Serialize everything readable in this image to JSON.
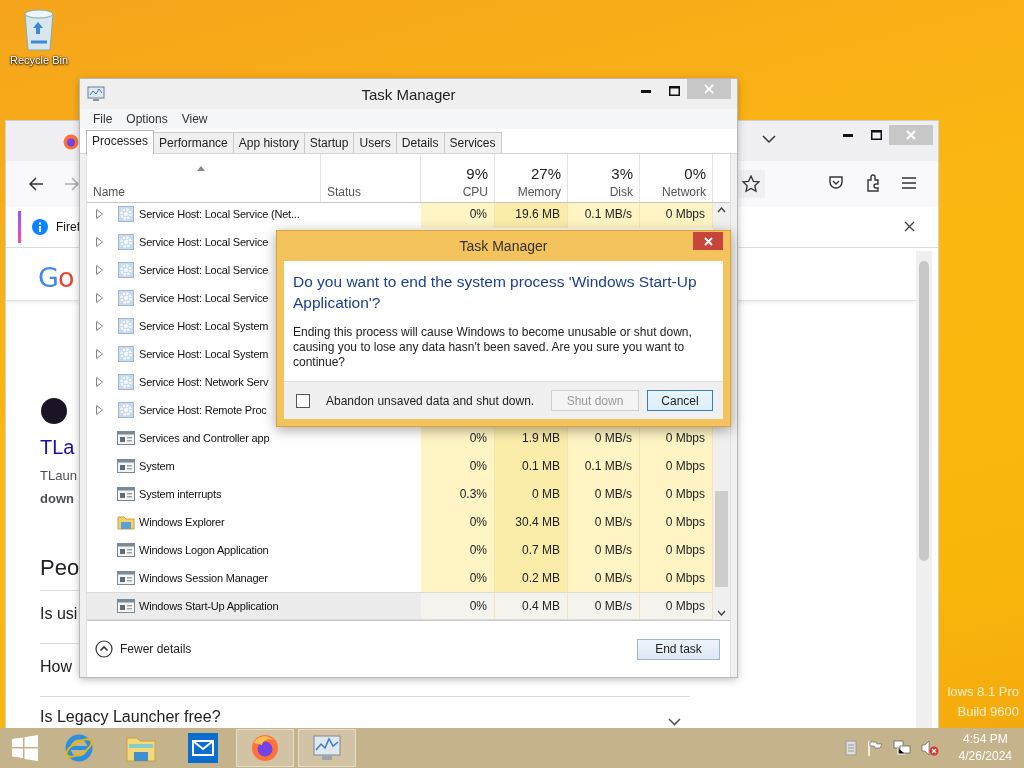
{
  "desktop": {
    "icons": [
      {
        "label": "Recycle Bin"
      }
    ],
    "edition_text": [
      "lows 8.1 Pro",
      "Build 9600"
    ]
  },
  "browser": {
    "notification": "Firef",
    "page": {
      "logo": "Go",
      "result": {
        "title": "TLa",
        "source": "TLaun",
        "snippet": "down"
      },
      "heading": "Peo",
      "questions": [
        "Is usi",
        "How",
        "Is Legacy Launcher free?"
      ]
    }
  },
  "task_manager": {
    "title": "Task Manager",
    "menu": [
      "File",
      "Options",
      "View"
    ],
    "tabs": [
      {
        "label": "Processes",
        "selected": true
      },
      {
        "label": "Performance",
        "selected": false
      },
      {
        "label": "App history",
        "selected": false
      },
      {
        "label": "Startup",
        "selected": false
      },
      {
        "label": "Users",
        "selected": false
      },
      {
        "label": "Details",
        "selected": false
      },
      {
        "label": "Services",
        "selected": false
      }
    ],
    "columns": [
      {
        "label": "Name"
      },
      {
        "label": "Status"
      },
      {
        "usage": "9%",
        "label": "CPU"
      },
      {
        "usage": "27%",
        "label": "Memory"
      },
      {
        "usage": "3%",
        "label": "Disk"
      },
      {
        "usage": "0%",
        "label": "Network"
      }
    ],
    "rows": [
      {
        "name": "Service Host: Local Service (Net...",
        "kind": "service",
        "expandable": true,
        "selected": false,
        "cpu": "0%",
        "memory": "19.6 MB",
        "disk": "0.1 MB/s",
        "network": "0 Mbps"
      },
      {
        "name": "Service Host: Local Service",
        "kind": "service",
        "expandable": true,
        "selected": false
      },
      {
        "name": "Service Host: Local Service",
        "kind": "service",
        "expandable": true,
        "selected": false
      },
      {
        "name": "Service Host: Local Service",
        "kind": "service",
        "expandable": true,
        "selected": false
      },
      {
        "name": "Service Host: Local System",
        "kind": "service",
        "expandable": true,
        "selected": false
      },
      {
        "name": "Service Host: Local System",
        "kind": "service",
        "expandable": true,
        "selected": false
      },
      {
        "name": "Service Host: Network Serv",
        "kind": "service",
        "expandable": true,
        "selected": false
      },
      {
        "name": "Service Host: Remote Proc",
        "kind": "service",
        "expandable": true,
        "selected": false
      },
      {
        "name": "Services and Controller app",
        "kind": "app",
        "expandable": false,
        "selected": false,
        "cpu": "0%",
        "memory": "1.9 MB",
        "disk": "0 MB/s",
        "network": "0 Mbps"
      },
      {
        "name": "System",
        "kind": "app",
        "expandable": false,
        "selected": false,
        "cpu": "0%",
        "memory": "0.1 MB",
        "disk": "0.1 MB/s",
        "network": "0 Mbps"
      },
      {
        "name": "System interrupts",
        "kind": "app",
        "expandable": false,
        "selected": false,
        "cpu": "0.3%",
        "memory": "0 MB",
        "disk": "0 MB/s",
        "network": "0 Mbps"
      },
      {
        "name": "Windows Explorer",
        "kind": "explorer",
        "expandable": false,
        "selected": false,
        "cpu": "0%",
        "memory": "30.4 MB",
        "disk": "0 MB/s",
        "network": "0 Mbps"
      },
      {
        "name": "Windows Logon Application",
        "kind": "app",
        "expandable": false,
        "selected": false,
        "cpu": "0%",
        "memory": "0.7 MB",
        "disk": "0 MB/s",
        "network": "0 Mbps"
      },
      {
        "name": "Windows Session Manager",
        "kind": "app",
        "expandable": false,
        "selected": false,
        "cpu": "0%",
        "memory": "0.2 MB",
        "disk": "0 MB/s",
        "network": "0 Mbps"
      },
      {
        "name": "Windows Start-Up Application",
        "kind": "app",
        "expandable": false,
        "selected": true,
        "cpu": "0%",
        "memory": "0.4 MB",
        "disk": "0 MB/s",
        "network": "0 Mbps"
      }
    ],
    "fewer_details": "Fewer details",
    "end_task": "End task"
  },
  "dialog": {
    "title": "Task Manager",
    "heading": "Do you want to end the system process 'Windows Start-Up Application'?",
    "message": "Ending this process will cause Windows to become unusable or shut down, causing you to lose any data hasn't been saved. Are you sure you want to continue?",
    "checkbox": {
      "label": "Abandon unsaved data and shut down.",
      "checked": false
    },
    "buttons": [
      {
        "label": "Shut down",
        "disabled": true
      },
      {
        "label": "Cancel",
        "disabled": false
      }
    ]
  },
  "taskbar": {
    "apps": [
      {
        "kind": "ie",
        "active": false
      },
      {
        "kind": "explorer",
        "active": false
      },
      {
        "kind": "mail",
        "active": false
      },
      {
        "kind": "firefox",
        "active": true
      },
      {
        "kind": "task-manager",
        "active": true
      }
    ],
    "clock": {
      "time": "4:54 PM",
      "date": "4/26/2024"
    }
  }
}
